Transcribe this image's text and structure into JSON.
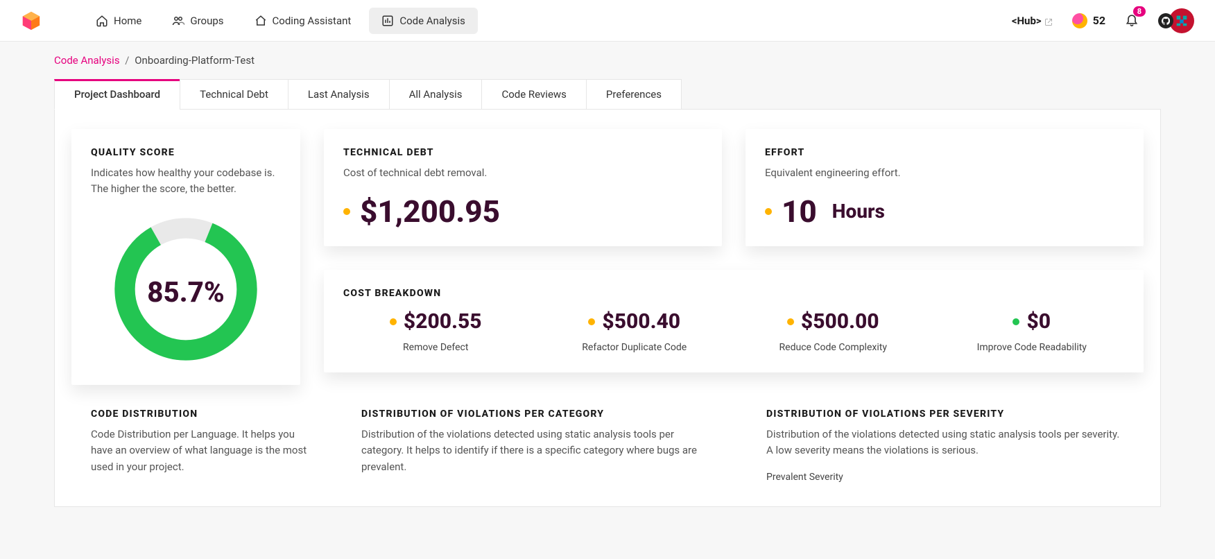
{
  "nav": {
    "items": [
      {
        "label": "Home",
        "icon": "home-icon"
      },
      {
        "label": "Groups",
        "icon": "groups-icon"
      },
      {
        "label": "Coding Assistant",
        "icon": "assistant-icon"
      },
      {
        "label": "Code Analysis",
        "icon": "analysis-icon",
        "active": true
      }
    ],
    "hub_label": "<Hub>",
    "coin_count": "52",
    "notification_count": "8"
  },
  "breadcrumb": {
    "root": "Code Analysis",
    "current": "Onboarding-Platform-Test"
  },
  "tabs": [
    "Project Dashboard",
    "Technical Debt",
    "Last Analysis",
    "All Analysis",
    "Code Reviews",
    "Preferences"
  ],
  "active_tab": "Project Dashboard",
  "quality": {
    "title": "QUALITY SCORE",
    "subtitle": "Indicates how healthy your codebase is. The higher the score, the better.",
    "value_text": "85.7%"
  },
  "debt": {
    "title": "TECHNICAL DEBT",
    "subtitle": "Cost of technical debt removal.",
    "value": "$1,200.95"
  },
  "effort": {
    "title": "EFFORT",
    "subtitle": "Equivalent engineering effort.",
    "value": "10",
    "unit": "Hours"
  },
  "breakdown": {
    "title": "COST BREAKDOWN",
    "items": [
      {
        "value": "$200.55",
        "label": "Remove Defect",
        "dot": "amber"
      },
      {
        "value": "$500.40",
        "label": "Refactor Duplicate Code",
        "dot": "amber"
      },
      {
        "value": "$500.00",
        "label": "Reduce Code Complexity",
        "dot": "amber"
      },
      {
        "value": "$0",
        "label": "Improve Code Readability",
        "dot": "green"
      }
    ]
  },
  "lower": {
    "code_dist": {
      "title": "CODE DISTRIBUTION",
      "subtitle": "Code Distribution per Language. It helps you have an overview of what language is the most used in your project."
    },
    "viol_cat": {
      "title": "DISTRIBUTION OF VIOLATIONS PER CATEGORY",
      "subtitle": "Distribution of the violations detected using static analysis tools per category. It helps to identify if there is a specific category where bugs are prevalent."
    },
    "viol_sev": {
      "title": "DISTRIBUTION OF VIOLATIONS PER SEVERITY",
      "subtitle": "Distribution of the violations detected using static analysis tools per severity. A low severity means the violations is serious.",
      "mini": "Prevalent Severity"
    }
  },
  "chart_data": {
    "type": "pie",
    "title": "Quality Score",
    "values": [
      85.7,
      14.3
    ],
    "categories": [
      "score",
      "remaining"
    ],
    "colors": [
      "#23c552",
      "#e9e9e9"
    ]
  }
}
